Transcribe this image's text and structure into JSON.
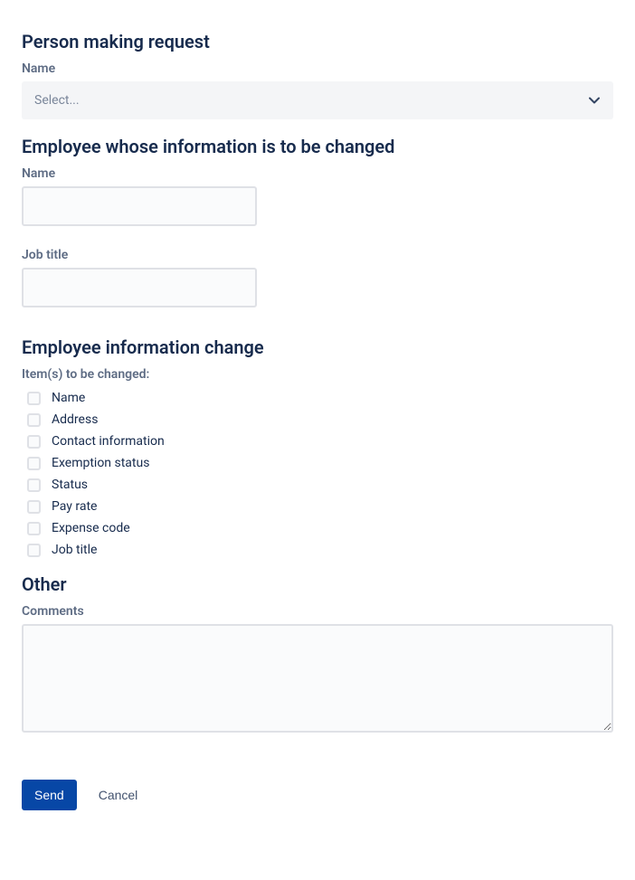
{
  "sections": {
    "requester": {
      "heading": "Person making request",
      "name_label": "Name",
      "select_placeholder": "Select..."
    },
    "employee": {
      "heading": "Employee whose information is to be changed",
      "name_label": "Name",
      "job_title_label": "Job title"
    },
    "change": {
      "heading": "Employee information change",
      "items_label": "Item(s) to be changed:",
      "options": [
        "Name",
        "Address",
        "Contact information",
        "Exemption status",
        "Status",
        "Pay rate",
        "Expense code",
        "Job title"
      ]
    },
    "other": {
      "heading": "Other",
      "comments_label": "Comments"
    }
  },
  "buttons": {
    "send": "Send",
    "cancel": "Cancel"
  }
}
